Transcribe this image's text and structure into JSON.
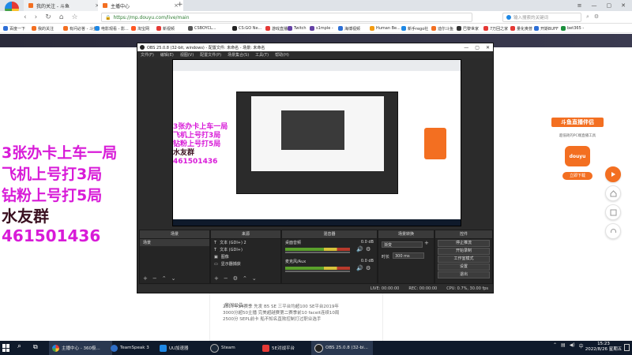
{
  "browser": {
    "tabs": [
      {
        "label": "我的关注 - 斗鱼",
        "active": false
      },
      {
        "label": "主播中心",
        "active": true
      }
    ],
    "address": "https://mp.douyu.com/live/main",
    "search_placeholder": "输入搜索的关键词",
    "bookmarks": [
      "百度一下",
      "我的关注",
      "有问必答 - 斗鱼",
      "电影观看 - 影...",
      "淘宝网",
      "新视频",
      "CSBOYCL...",
      "CS:GO Ne...",
      "游戏直播",
      "Twitch",
      "s1mple -",
      "海博视频",
      "Human Be...",
      "新手rego社",
      "迪尔斗鱼",
      "巴黎世家",
      "7万回之家",
      "量化奥普",
      "开斯BUFF",
      "bet365 -"
    ]
  },
  "obs": {
    "title": "OBS 25.0.8 (32-bit, windows) - 配置文件: 未命名 - 场景: 未命名",
    "menu": [
      "文件(F)",
      "编辑(E)",
      "视图(V)",
      "配置文件(P)",
      "场景集合(S)",
      "工具(T)",
      "帮助(H)"
    ],
    "docks": {
      "scenes": {
        "title": "场景",
        "items": [
          "场景"
        ]
      },
      "sources": {
        "title": "来源",
        "items": [
          "文本 (GDI+) 2",
          "文本 (GDI+)",
          "图像",
          "显示器捕获"
        ]
      },
      "mixer": {
        "title": "混音器",
        "rows": [
          {
            "name": "桌面音频",
            "level": "0.0 dB"
          },
          {
            "name": "麦克风/Aux",
            "level": "0.0 dB"
          }
        ]
      },
      "transitions": {
        "title": "场景转换",
        "type": "渐变",
        "duration_label": "时长",
        "duration": "300 ms"
      },
      "controls": {
        "title": "控件",
        "buttons": [
          "停止推流",
          "开始录制",
          "工作室模式",
          "设置",
          "退出"
        ]
      }
    },
    "status": {
      "live": "LIVE: 00:00:00",
      "rec": "REC: 00:00:00",
      "cpu": "CPU: 0.7%, 30.00 fps"
    }
  },
  "overlay": {
    "line1": "3张办卡上车一局",
    "line2": "飞机上号打3局",
    "line3": "钻粉上号打5局",
    "line4": "水友群",
    "line5": "461501436"
  },
  "page": {
    "label": "房间公告:",
    "notice": "2017年S4赛季 先发 B5 SE 三平台均超100 SE平台2019年 3000分超50主播 完美超越赛第二赛季前10 faceit连续10局 2500分 SEPL前卡 船不知名直败控制打过职业选手"
  },
  "promo": {
    "title": "斗鱼直播伴侣",
    "subtitle": "超低耗的PC端直播工具",
    "button": "立即下载",
    "mascot": "douyu"
  },
  "side_icons": [
    "play-icon",
    "home-icon",
    "collapse-icon",
    "headset-icon"
  ],
  "taskbar": {
    "items": [
      "主播中心 - 360极...",
      "TeamSpeak 3",
      "UU加速器",
      "Steam",
      "5E对战平台",
      "OBS 25.0.8 (32-bi..."
    ],
    "time": "15:23",
    "date": "2022/8/26 星期五"
  },
  "colors": {
    "overlay_magenta": "#d81bd8",
    "overlay_dark": "#3a1020",
    "douyu_orange": "#f36f21",
    "obs_bg": "#2b2b2b",
    "taskbar_bg": "#0f1a2b"
  }
}
